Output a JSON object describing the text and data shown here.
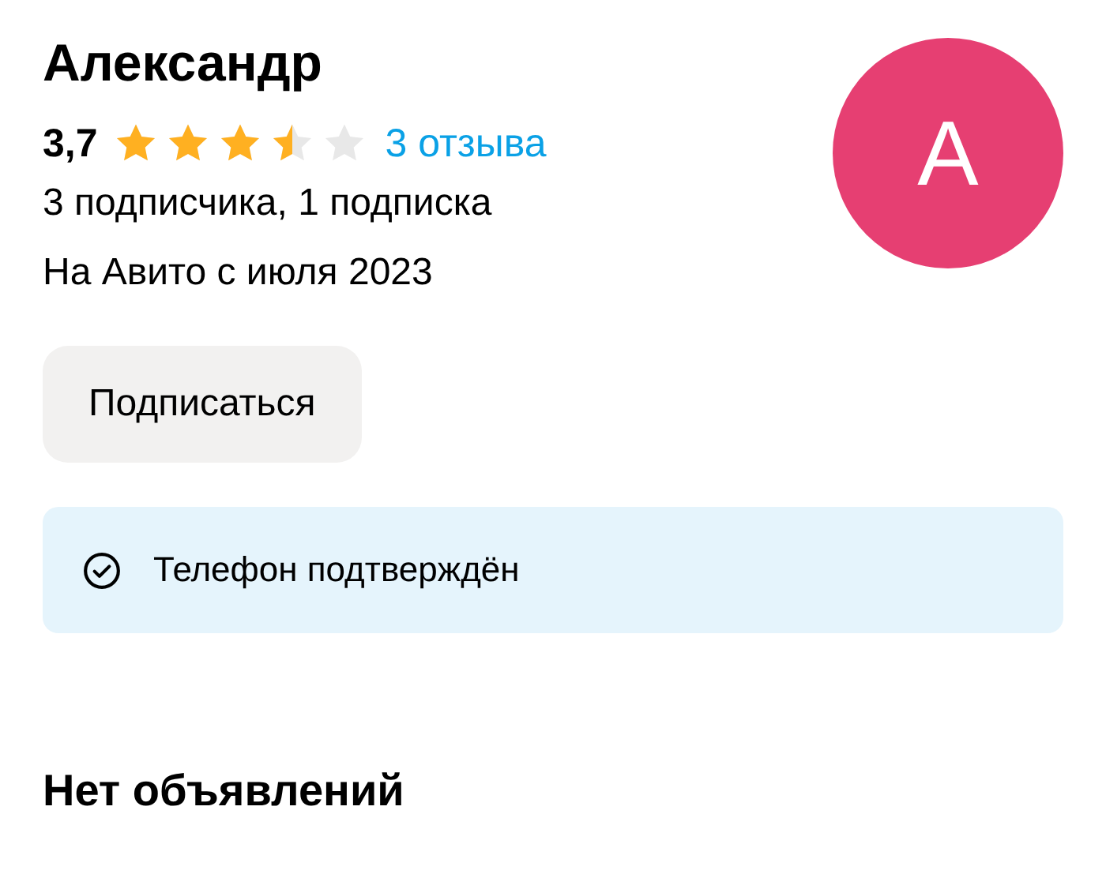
{
  "profile": {
    "name": "Александр",
    "rating": "3,7",
    "stars": 3.5,
    "reviews_link": "3 отзыва",
    "followers": "3 подписчика, 1 подписка",
    "member_since": "На Авито с июля 2023",
    "avatar_letter": "А"
  },
  "subscribe_button": "Подписаться",
  "verification": {
    "text": "Телефон подтверждён",
    "verified": true
  },
  "listings_heading": "Нет объявлений"
}
